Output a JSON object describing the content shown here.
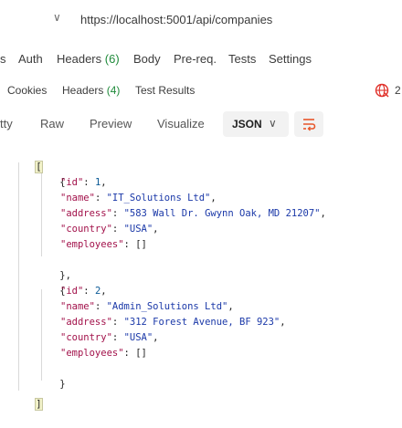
{
  "url": {
    "chevron": "∨",
    "value": "https://localhost:5001/api/companies"
  },
  "request_tabs": [
    {
      "label": "s"
    },
    {
      "label": "Auth"
    },
    {
      "label": "Headers",
      "count": "(6)"
    },
    {
      "label": "Body"
    },
    {
      "label": "Pre-req."
    },
    {
      "label": "Tests"
    },
    {
      "label": "Settings"
    }
  ],
  "response_tabs": [
    {
      "label": "Cookies"
    },
    {
      "label": "Headers",
      "count": "(4)"
    },
    {
      "label": "Test Results"
    }
  ],
  "response_extra": "2",
  "view_tabs": {
    "pretty": "tty",
    "raw": "Raw",
    "preview": "Preview",
    "visualize": "Visualize",
    "format": "JSON",
    "format_chevron": "∨"
  },
  "colors": {
    "key": "#a2114a",
    "string": "#1a38a8",
    "number": "#0b5a96",
    "count": "#1f8a3a",
    "wrap_icon": "#e8562a",
    "globe_icon": "#e0312a"
  },
  "json_body": {
    "open_bracket": "[",
    "close_bracket": "]",
    "items": [
      {
        "open": "{",
        "lines": [
          {
            "key": "\"id\"",
            "sep": ": ",
            "value": "1",
            "type": "n",
            "end": ","
          },
          {
            "key": "\"name\"",
            "sep": ": ",
            "value": "\"IT_Solutions Ltd\"",
            "type": "s",
            "end": ","
          },
          {
            "key": "\"address\"",
            "sep": ": ",
            "value": "\"583 Wall Dr. Gwynn Oak, MD 21207\"",
            "type": "s",
            "end": ","
          },
          {
            "key": "\"country\"",
            "sep": ": ",
            "value": "\"USA\"",
            "type": "s",
            "end": ","
          },
          {
            "key": "\"employees\"",
            "sep": ": ",
            "value": "[]",
            "type": "p",
            "end": ""
          }
        ],
        "close": "},"
      },
      {
        "open": "{",
        "lines": [
          {
            "key": "\"id\"",
            "sep": ": ",
            "value": "2",
            "type": "n",
            "end": ","
          },
          {
            "key": "\"name\"",
            "sep": ": ",
            "value": "\"Admin_Solutions Ltd\"",
            "type": "s",
            "end": ","
          },
          {
            "key": "\"address\"",
            "sep": ": ",
            "value": "\"312 Forest Avenue, BF 923\"",
            "type": "s",
            "end": ","
          },
          {
            "key": "\"country\"",
            "sep": ": ",
            "value": "\"USA\"",
            "type": "s",
            "end": ","
          },
          {
            "key": "\"employees\"",
            "sep": ": ",
            "value": "[]",
            "type": "p",
            "end": ""
          }
        ],
        "close": "}"
      }
    ]
  }
}
